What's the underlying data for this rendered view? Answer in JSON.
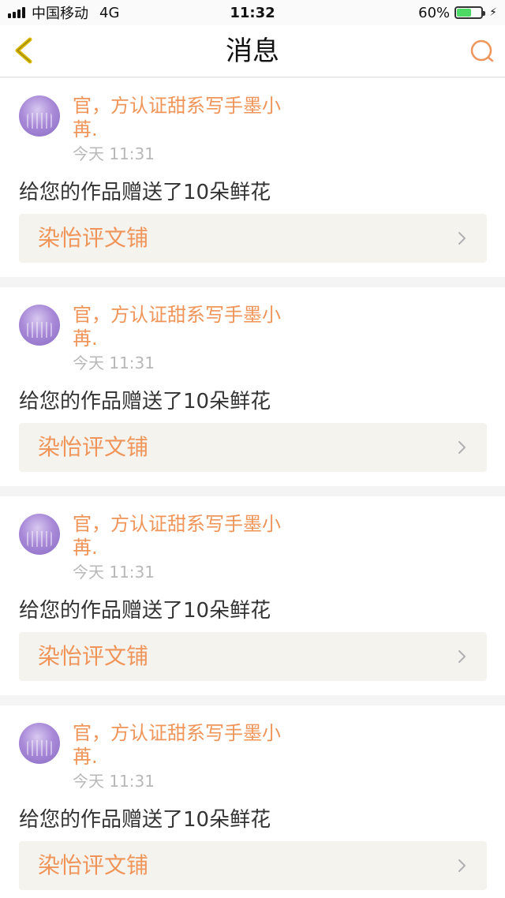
{
  "status_bar": {
    "carrier": "中国移动",
    "network": "4G",
    "time": "11:32",
    "battery_text": "60%",
    "battery_level": 0.6
  },
  "nav": {
    "title": "消息",
    "back_icon": "chevron-left-icon",
    "search_icon": "search-icon"
  },
  "colors": {
    "accent": "#f0955a",
    "back_icon": "#d9b800",
    "work_bg": "#f4f3ee"
  },
  "messages": [
    {
      "sender": "官，方认证甜系写手墨小苒.",
      "time": "今天 11:31",
      "text": "给您的作品赠送了10朵鲜花",
      "work": "染怡评文铺"
    },
    {
      "sender": "官，方认证甜系写手墨小苒.",
      "time": "今天 11:31",
      "text": "给您的作品赠送了10朵鲜花",
      "work": "染怡评文铺"
    },
    {
      "sender": "官，方认证甜系写手墨小苒.",
      "time": "今天 11:31",
      "text": "给您的作品赠送了10朵鲜花",
      "work": "染怡评文铺"
    },
    {
      "sender": "官，方认证甜系写手墨小苒.",
      "time": "今天 11:31",
      "text": "给您的作品赠送了10朵鲜花",
      "work": "染怡评文铺"
    }
  ]
}
